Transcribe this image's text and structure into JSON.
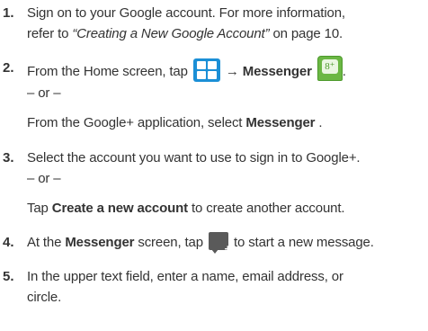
{
  "steps": [
    {
      "num": "1.",
      "text_a": "Sign on to your Google account. For more information,",
      "text_b_pre": "refer to ",
      "text_b_ital": "“Creating a New Google Account”",
      "text_b_post": "  on page 10."
    },
    {
      "num": "2.",
      "pre": "From the Home screen, tap ",
      "arrow": " → ",
      "bold": "Messenger",
      "post": ".",
      "or": "– or –",
      "alt_pre": "From the Google+ application, select ",
      "alt_bold": "Messenger",
      "alt_post": " ."
    },
    {
      "num": "3.",
      "text": "Select the account you want to use to sign in to Google+.",
      "or": "– or –",
      "alt_pre": "Tap ",
      "alt_bold": "Create a new account",
      "alt_post": " to create another account."
    },
    {
      "num": "4.",
      "pre": "At the ",
      "bold": "Messenger",
      "mid": " screen, tap ",
      "post": " to start a new message."
    },
    {
      "num": "5.",
      "text_a": "In the upper text field, enter a name, email address, or",
      "text_b": "circle."
    }
  ],
  "icons": {
    "home_icon": "home-screen-grid-icon",
    "gplus_icon": "google-plus-messenger-icon",
    "gplus_glyph": "8⁺",
    "compose_icon": "new-message-icon",
    "compose_plus": "+"
  },
  "colors": {
    "text": "#333333",
    "home_icon_blue": "#1b8fd6",
    "gplus_green": "#6bb744"
  }
}
